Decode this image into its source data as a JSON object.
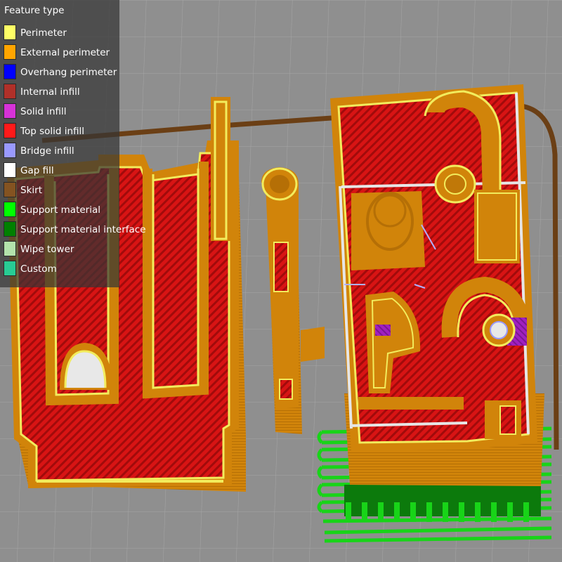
{
  "legend": {
    "title": "Feature type",
    "items": [
      {
        "label": "Perimeter",
        "color": "#ffff66"
      },
      {
        "label": "External perimeter",
        "color": "#ffa500"
      },
      {
        "label": "Overhang perimeter",
        "color": "#0000ff"
      },
      {
        "label": "Internal infill",
        "color": "#b03029"
      },
      {
        "label": "Solid infill",
        "color": "#d732d7"
      },
      {
        "label": "Top solid infill",
        "color": "#ff1a1a"
      },
      {
        "label": "Bridge infill",
        "color": "#9999ff"
      },
      {
        "label": "Gap fill",
        "color": "#ffffff"
      },
      {
        "label": "Skirt",
        "color": "#845321"
      },
      {
        "label": "Support material",
        "color": "#00ff00"
      },
      {
        "label": "Support material interface",
        "color": "#008000"
      },
      {
        "label": "Wipe tower",
        "color": "#b3e3ab"
      },
      {
        "label": "Custom",
        "color": "#28cc94"
      }
    ]
  },
  "colors": {
    "background": "#8f8f8f",
    "grid": "#a6a6a6",
    "wall": "#d1840a",
    "wall_dark": "#9c5f07",
    "top_infill": "#d81414",
    "top_infill_stripe": "#a10b0b",
    "perimeter": "#f2ec5c",
    "skirt": "#6b3f15",
    "support": "#18d418",
    "support_interface": "#0c7a0c",
    "solid_infill": "#a020c0",
    "bridge": "#b0b0ff"
  }
}
